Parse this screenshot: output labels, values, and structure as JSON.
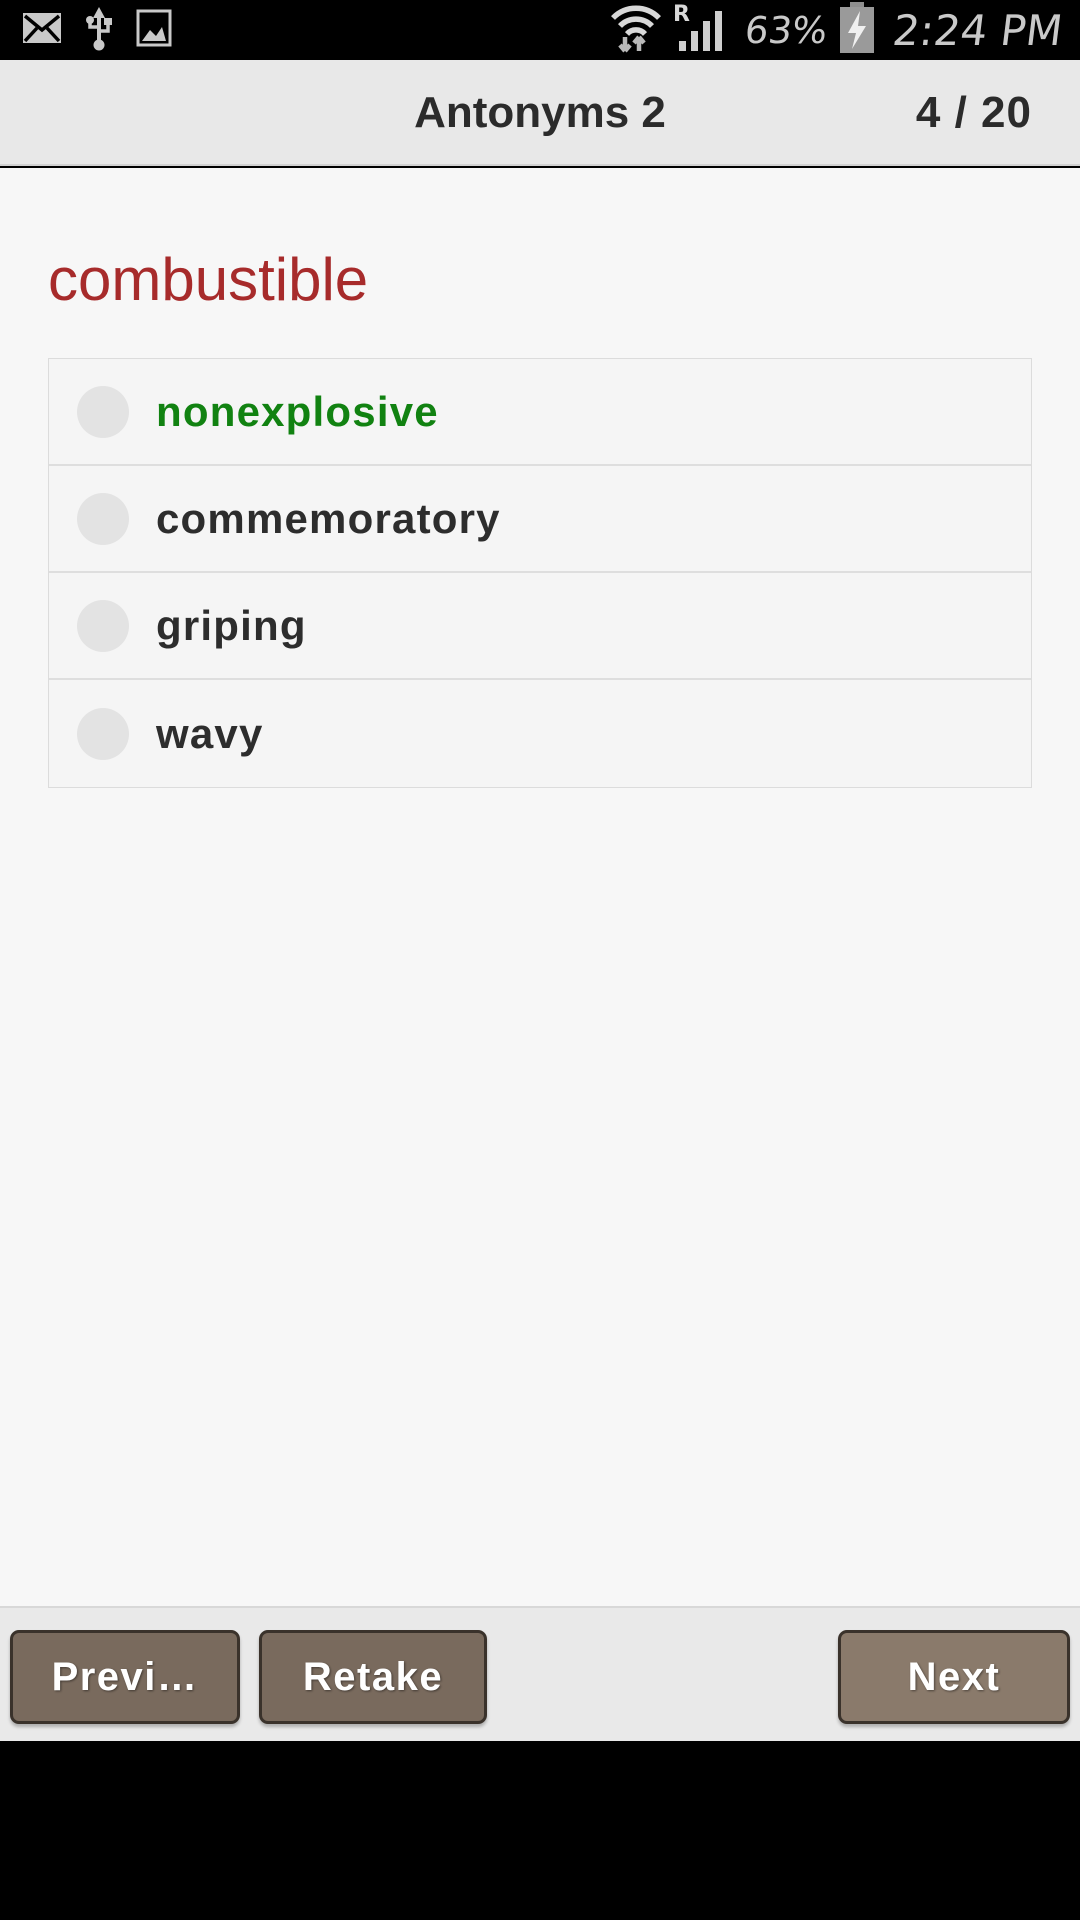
{
  "statusbar": {
    "left_icons": [
      "mail-icon",
      "usb-icon",
      "screenshot-image-icon"
    ],
    "right_icons": [
      "wifi-updown-icon",
      "roaming-signal-icon",
      "charging-battery-icon"
    ],
    "roaming_label": "R",
    "battery_percent": "63%",
    "clock": "2:24 PM"
  },
  "actionbar": {
    "title": "Antonyms 2",
    "counter": "4 / 20"
  },
  "quiz": {
    "question_word": "combustible",
    "question_color": "#a72b2b",
    "correct_color": "#118211",
    "options": [
      {
        "label": "nonexplosive",
        "state": "correct",
        "selected": false
      },
      {
        "label": "commemoratory",
        "state": "normal",
        "selected": false
      },
      {
        "label": "griping",
        "state": "normal",
        "selected": false
      },
      {
        "label": "wavy",
        "state": "normal",
        "selected": false
      }
    ]
  },
  "buttons": {
    "previous": "Previ…",
    "retake": "Retake",
    "next": "Next",
    "color": "#796a5d",
    "next_color": "#8a7a6b"
  }
}
